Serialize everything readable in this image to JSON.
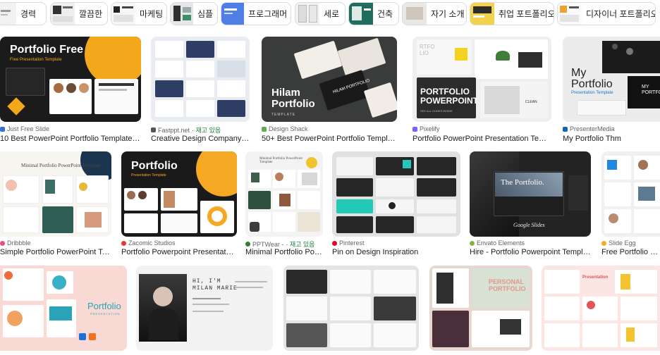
{
  "chips": [
    {
      "label": "경력"
    },
    {
      "label": "깔끔한"
    },
    {
      "label": "마케팅"
    },
    {
      "label": "심플"
    },
    {
      "label": "프로그래머"
    },
    {
      "label": "세로"
    },
    {
      "label": "건축"
    },
    {
      "label": "자기 소개"
    },
    {
      "label": "취업 포트폴리오"
    },
    {
      "label": "디자이너 포트폴리오"
    }
  ],
  "results": [
    {
      "source": "Just Free Slide",
      "stock": "",
      "title": "10 Best PowerPoint Portfolio Templates 20...",
      "img_text": "Portfolio Free",
      "img_sub": "Free Presentation Template"
    },
    {
      "source": "Fastppt.net",
      "stock": "· 재고 있음",
      "title": "Creative Design Company Port..."
    },
    {
      "source": "Design Shack",
      "stock": "",
      "title": "50+ Best PowerPoint Portfolio Templates 2...",
      "img_text": "Hilam Portfolio",
      "img_sub": "TEMPLATE",
      "img_small": "HILAM PORTFOLIO"
    },
    {
      "source": "Pixelify",
      "stock": "",
      "title": "Portfolio PowerPoint Presentation Templat...",
      "img_text": "PORTFOLIO POWERPOINT",
      "img_sub": "SEE ALL SLIDES INSIDE",
      "img_small": "RTFO LIO",
      "img_small2": "CLEAN"
    },
    {
      "source": "PresenterMedia",
      "stock": "",
      "title": "My Portfolio Thm",
      "img_text": "My Portfolio",
      "img_sub": "Presentation Template",
      "img_small": "MY PORTFOLIO"
    },
    {
      "source": "Dribbble",
      "stock": "",
      "title": "Simple Portfolio PowerPoint Temp...",
      "img_text": "Minimal Portfolio PowerPoint Template"
    },
    {
      "source": "Zacomic Studios",
      "stock": "",
      "title": "Portfolio Powerpoint Presentation ...",
      "img_text": "Portfolio",
      "img_sub": "Presentation Template"
    },
    {
      "source": "PPTWear -",
      "stock": "· 재고 있음",
      "title": "Minimal Portfolio Pow...",
      "img_text": "Minimal Portfolio PowerPoint Template"
    },
    {
      "source": "Pinterest",
      "stock": "",
      "title": "Pin on Design Inspiration"
    },
    {
      "source": "Envato Elements",
      "stock": "",
      "title": "Hire - Portfolio Powerpoint Template,...",
      "img_text": "The Portfolio.",
      "img_sub": "Google Slides"
    },
    {
      "source": "Slide Egg",
      "stock": "",
      "title": "Free Portfolio Goog"
    },
    {
      "img_text": "Portfolio",
      "img_sub": "PRESENTATION"
    },
    {
      "img_text": "HI, I'M MILAN MARIE"
    },
    {},
    {
      "img_text": "PERSONAL PORTFOLIO"
    },
    {
      "img_text": "Presentation"
    }
  ],
  "colors": {
    "border": "#dadce0",
    "stock_green": "#188038",
    "source_gray": "#5f6368"
  }
}
